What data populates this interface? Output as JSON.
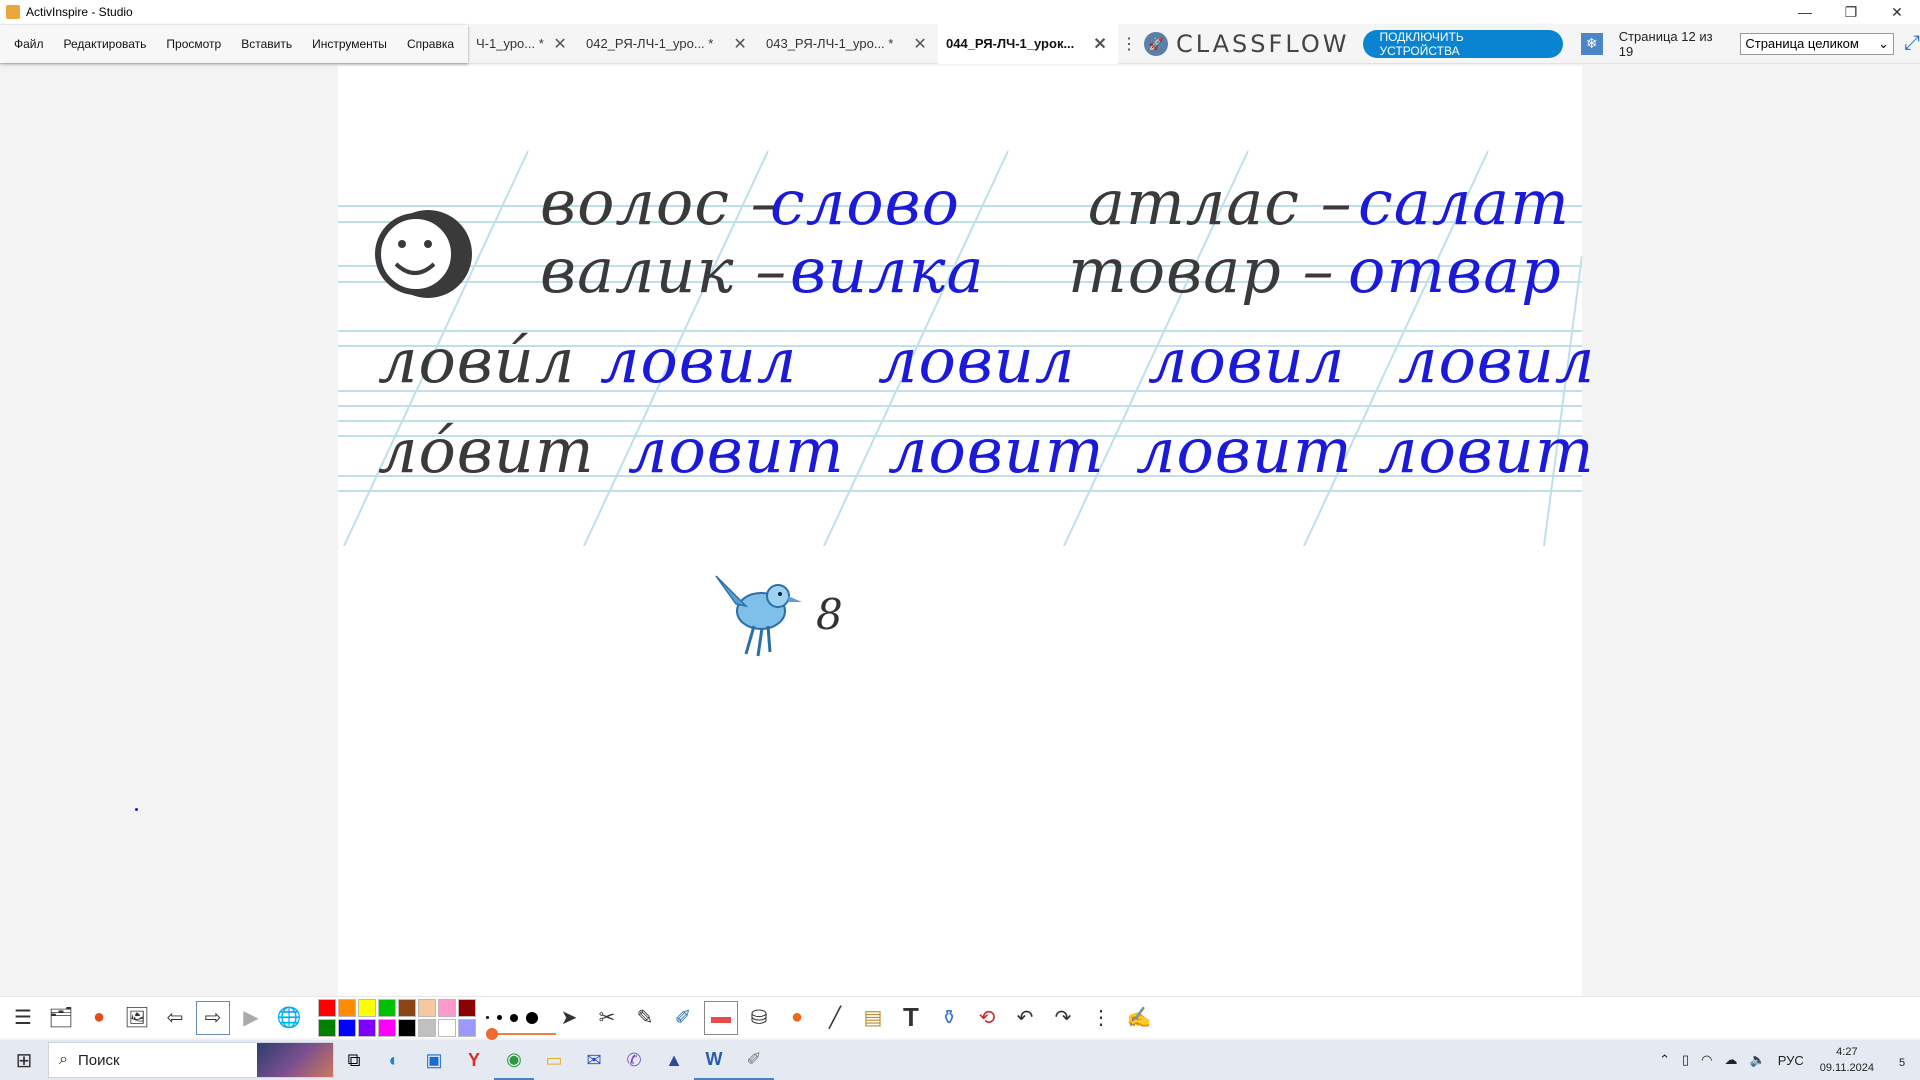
{
  "window": {
    "title": "ActivInspire - Studio",
    "minimize": "—",
    "restore": "❐",
    "close": "✕"
  },
  "menu": [
    "Файл",
    "Редактировать",
    "Просмотр",
    "Вставить",
    "Инструменты",
    "Справка"
  ],
  "tabs": [
    {
      "label": "Ч-1_уро... *",
      "close": "✕"
    },
    {
      "label": "042_РЯ-ЛЧ-1_уро... *",
      "close": "✕"
    },
    {
      "label": "043_РЯ-ЛЧ-1_уро... *",
      "close": "✕"
    },
    {
      "label": "044_РЯ-ЛЧ-1_урок...",
      "close": "✕"
    }
  ],
  "tabs_more": "⋮",
  "classflow": {
    "logo": "CLASSFLOW",
    "connect_label": "ПОДКЛЮЧИТЬ УСТРОЙСТВА"
  },
  "pager": {
    "label": "Страница 12 из 19",
    "zoom": "Страница целиком",
    "chevron": "⌄"
  },
  "canvas": {
    "rows": [
      [
        {
          "text": "волос –",
          "color": "black"
        },
        {
          "text": "слово",
          "color": "blue"
        },
        {
          "text": "атлас –",
          "color": "black"
        },
        {
          "text": "салат",
          "color": "blue"
        }
      ],
      [
        {
          "text": "валик –",
          "color": "black"
        },
        {
          "text": "вилка",
          "color": "blue"
        },
        {
          "text": "товар –",
          "color": "black"
        },
        {
          "text": "отвар",
          "color": "blue"
        }
      ],
      [
        {
          "text": "ловúл",
          "color": "black"
        },
        {
          "text": "ловил",
          "color": "blue"
        },
        {
          "text": "ловил",
          "color": "blue"
        },
        {
          "text": "ловил",
          "color": "blue"
        },
        {
          "text": "ловил",
          "color": "blue"
        }
      ],
      [
        {
          "text": "лóвит",
          "color": "black"
        },
        {
          "text": "ловит",
          "color": "blue"
        },
        {
          "text": "ловит",
          "color": "blue"
        },
        {
          "text": "ловит",
          "color": "blue"
        },
        {
          "text": "ловит",
          "color": "blue"
        }
      ]
    ],
    "page_number": "8",
    "ink_blue": "#1a1ad8",
    "ink_black": "#3a3a3a"
  },
  "toolbar": {
    "palette": [
      "#ff0000",
      "#ff8c00",
      "#ffff00",
      "#00c000",
      "#8b4513",
      "#f5c8a0",
      "#ff99cc",
      "#8b0000",
      "#008000",
      "#0000ff",
      "#8000ff",
      "#ff00ff",
      "#000000",
      "#c0c0c0",
      "#ffffff",
      "#9999ff"
    ]
  },
  "taskbar": {
    "search_placeholder": "Поиск",
    "language": "РУС",
    "time": "4:27",
    "date": "09.11.2024",
    "notifications": "5"
  }
}
